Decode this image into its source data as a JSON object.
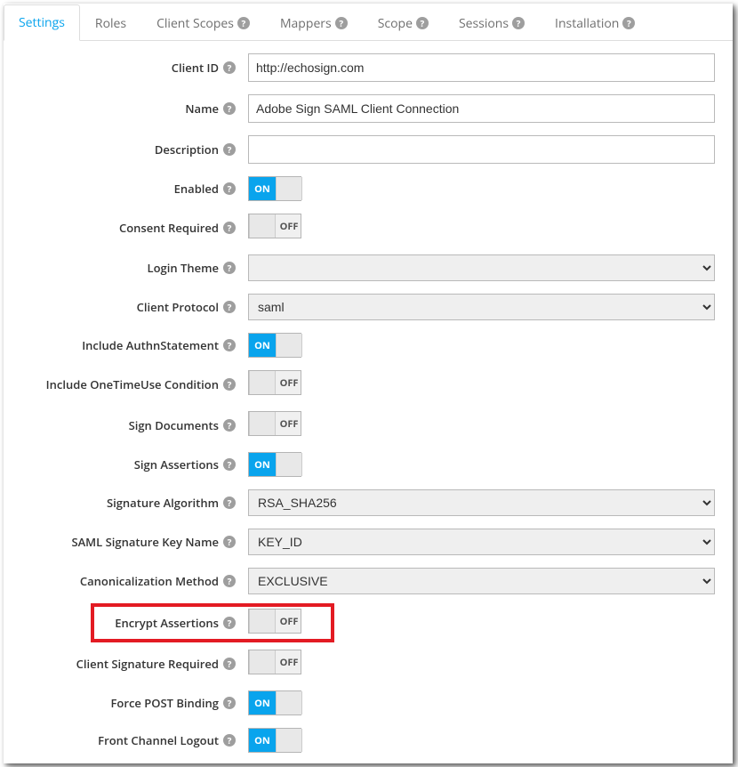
{
  "tabs": [
    {
      "label": "Settings",
      "help": false,
      "active": true
    },
    {
      "label": "Roles",
      "help": false
    },
    {
      "label": "Client Scopes",
      "help": true
    },
    {
      "label": "Mappers",
      "help": true
    },
    {
      "label": "Scope",
      "help": true
    },
    {
      "label": "Sessions",
      "help": true
    },
    {
      "label": "Installation",
      "help": true
    }
  ],
  "toggle_labels": {
    "on": "ON",
    "off": "OFF"
  },
  "fields": {
    "client_id": {
      "label": "Client ID",
      "value": "http://echosign.com"
    },
    "name": {
      "label": "Name",
      "value": "Adobe Sign SAML Client Connection"
    },
    "description": {
      "label": "Description",
      "value": ""
    },
    "enabled": {
      "label": "Enabled",
      "value": true
    },
    "consent": {
      "label": "Consent Required",
      "value": false
    },
    "login_theme": {
      "label": "Login Theme",
      "value": ""
    },
    "client_protocol": {
      "label": "Client Protocol",
      "value": "saml"
    },
    "authn": {
      "label": "Include AuthnStatement",
      "value": true
    },
    "onetime": {
      "label": "Include OneTimeUse Condition",
      "value": false
    },
    "sign_docs": {
      "label": "Sign Documents",
      "value": false
    },
    "sign_assert": {
      "label": "Sign Assertions",
      "value": true
    },
    "sig_alg": {
      "label": "Signature Algorithm",
      "value": "RSA_SHA256"
    },
    "sig_keyname": {
      "label": "SAML Signature Key Name",
      "value": "KEY_ID"
    },
    "canon": {
      "label": "Canonicalization Method",
      "value": "EXCLUSIVE"
    },
    "encrypt_assert": {
      "label": "Encrypt Assertions",
      "value": false
    },
    "client_sig_req": {
      "label": "Client Signature Required",
      "value": false
    },
    "force_post": {
      "label": "Force POST Binding",
      "value": true
    },
    "front_logout": {
      "label": "Front Channel Logout",
      "value": true
    }
  }
}
